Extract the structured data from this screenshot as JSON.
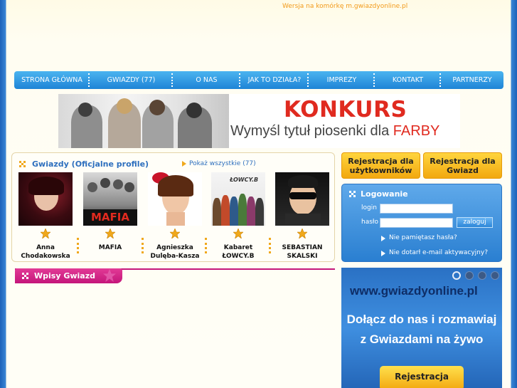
{
  "header": {
    "mobile_link": "Wersja na komórkę m.gwiazdyonline.pl"
  },
  "nav": {
    "items": [
      {
        "label": "STRONA GŁÓWNA"
      },
      {
        "label": "GWIAZDY (77)"
      },
      {
        "label": "O NAS"
      },
      {
        "label": "JAK TO DZIAŁA?"
      },
      {
        "label": "IMPREZY"
      },
      {
        "label": "KONTAKT"
      },
      {
        "label": "PARTNERZY"
      }
    ]
  },
  "banner": {
    "title": "KONKURS",
    "subtitle": "Wymyśl tytuł piosenki dla",
    "subtitle_highlight": "FARBY"
  },
  "celebrities": {
    "title": "Gwiazdy (Oficjalne profile)",
    "show_all": "Pokaż wszystkie (77)",
    "items": [
      {
        "name_line1": "Anna",
        "name_line2": "Chodakowska"
      },
      {
        "name_line1": "MAFIA",
        "name_line2": ""
      },
      {
        "name_line1": "Agnieszka",
        "name_line2": "Dulęba-Kasza"
      },
      {
        "name_line1": "Kabaret",
        "name_line2": "ŁOWCY.B"
      },
      {
        "name_line1": "SEBASTIAN",
        "name_line2": "SKALSKI"
      }
    ],
    "mafia_logo": "MAFIA",
    "lowcy_logo": "ŁOWCY.B"
  },
  "posts": {
    "title": "Wpisy Gwiazd"
  },
  "registration": {
    "users_line1": "Rejestracja dla",
    "users_line2": "użytkowników",
    "stars_line1": "Rejestracja dla",
    "stars_line2": "Gwiazd"
  },
  "login": {
    "title": "Logowanie",
    "login_label": "login",
    "password_label": "hasło",
    "submit": "zaloguj",
    "forgot_password": "Nie pamiętasz hasła?",
    "no_activation": "Nie dotarł e-mail aktywacyjny?"
  },
  "promo": {
    "url": "www.gwiazdyonline.pl",
    "line1": "Dołącz do nas i rozmawiaj",
    "line2": "z Gwiazdami na żywo",
    "button": "Rejestracja"
  },
  "colors": {
    "accent_blue": "#2d6fbe",
    "accent_orange": "#f0a81c",
    "accent_pink": "#c4167a",
    "banner_red": "#e02a1f"
  }
}
